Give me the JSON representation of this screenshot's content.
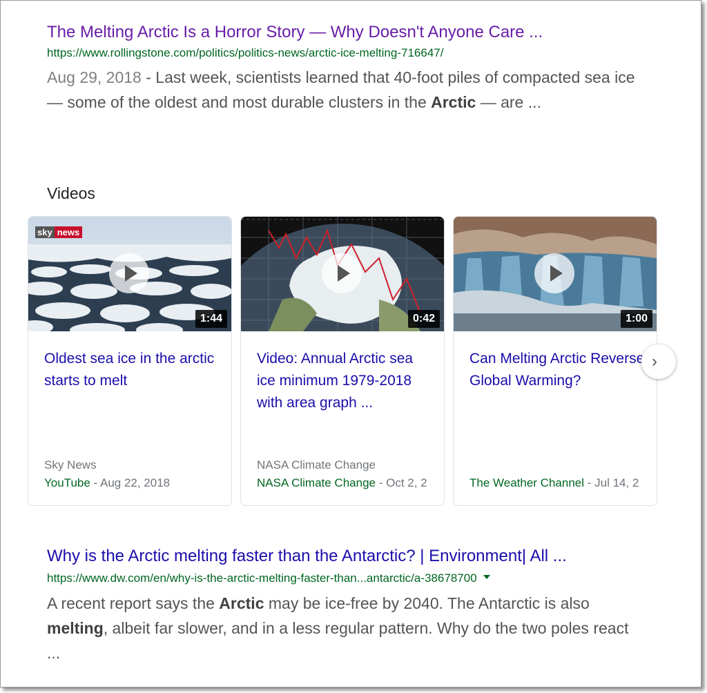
{
  "result1": {
    "title": "The Melting Arctic Is a Horror Story — Why Doesn't Anyone Care ...",
    "url": "https://www.rollingstone.com/politics/politics-news/arctic-ice-melting-716647/",
    "date": "Aug 29, 2018",
    "snippet_a": " - Last week, scientists learned that 40-foot piles of compacted sea ice — some of the oldest and most durable clusters in the ",
    "snippet_bold": "Arctic",
    "snippet_b": " — are ..."
  },
  "videos": {
    "heading": "Videos",
    "items": [
      {
        "title": "Oldest sea ice in the arctic starts to melt",
        "duration": "1:44",
        "source": "Sky News",
        "publisher": "YouTube",
        "date": " - Aug 22, 2018",
        "logo_a": "sky",
        "logo_b": "news"
      },
      {
        "title": "Video: Annual Arctic sea ice minimum 1979-2018 with area graph ...",
        "duration": "0:42",
        "source": "NASA Climate Change",
        "publisher": "NASA Climate Change",
        "date": " - Oct 2, 2"
      },
      {
        "title": "Can Melting Arctic Reverse Global Warming?",
        "duration": "1:00",
        "source": "",
        "publisher": "The Weather Channel",
        "date": " - Jul 14, 2"
      }
    ],
    "next_icon": "chevron-right-icon",
    "next_glyph": "›"
  },
  "result2": {
    "title": "Why is the Arctic melting faster than the Antarctic? | Environment| All ...",
    "url": "https://www.dw.com/en/why-is-the-arctic-melting-faster-than...antarctic/a-38678700",
    "s1": "A recent report says the ",
    "b1": "Arctic",
    "s2": " may be ice-free by 2040. The Antarctic is also ",
    "b2": "melting",
    "s3": ", albeit far slower, and in a less regular pattern. Why do the two poles react ..."
  }
}
